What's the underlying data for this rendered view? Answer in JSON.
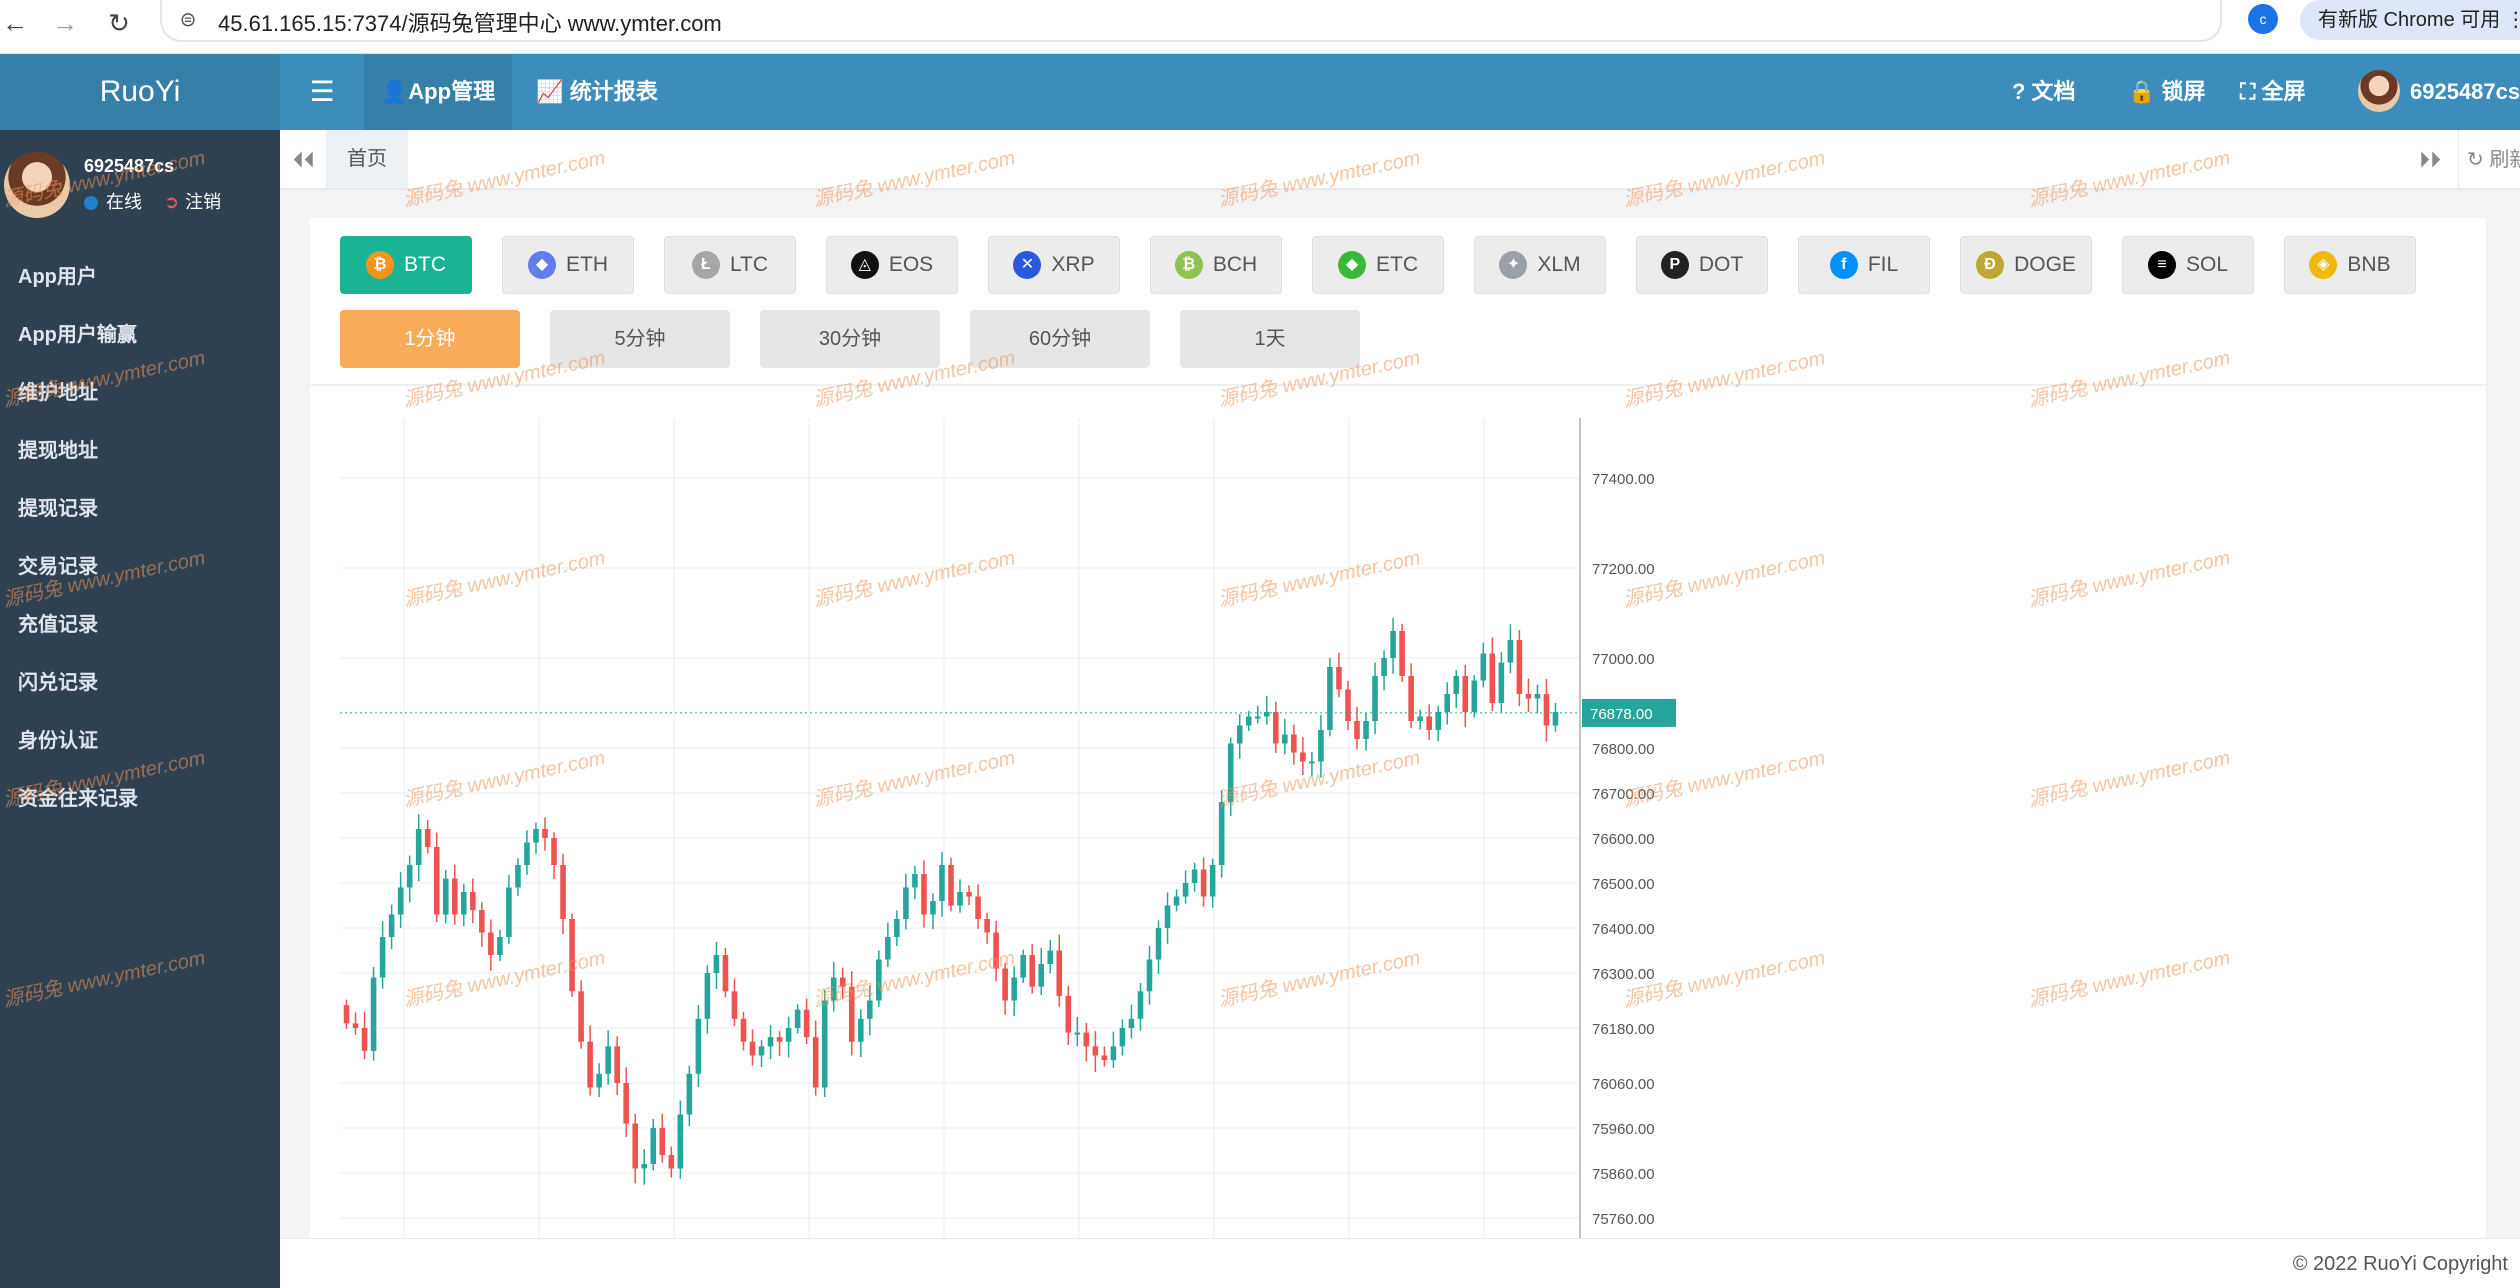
{
  "browser": {
    "back": "←",
    "forward": "→",
    "reload": "↻",
    "site_icon": "⊜",
    "url": "45.61.165.15:7374/源码兔管理中心  www.ymter.com",
    "profile_letter": "c",
    "update_label": "有新版 Chrome 可用  ⋮"
  },
  "header": {
    "brand": "RuoYi",
    "menu_icon": "☰",
    "nav": [
      {
        "label": "👤App管理"
      },
      {
        "label": "📈 统计报表"
      }
    ],
    "right": {
      "docs": "? 文档",
      "lock": "🔒 锁屏",
      "fullscreen": "⛶ 全屏",
      "username": "6925487cs"
    }
  },
  "sidebar": {
    "user": {
      "name": "6925487cs",
      "online": "在线",
      "logout": "注销"
    },
    "items": [
      {
        "label": "App用户"
      },
      {
        "label": "App用户输赢"
      },
      {
        "label": "维护地址"
      },
      {
        "label": "提现地址"
      },
      {
        "label": "提现记录"
      },
      {
        "label": "交易记录"
      },
      {
        "label": "充值记录"
      },
      {
        "label": "闪兑记录"
      },
      {
        "label": "身份认证"
      },
      {
        "label": "资金往来记录"
      }
    ]
  },
  "tabs": {
    "prev": "⏴⏴",
    "next": "⏵⏵",
    "home": "首页",
    "refresh": "↻ 刷新"
  },
  "coins": [
    {
      "label": "BTC",
      "icon": "bitcoin-icon",
      "symbol": "₿",
      "color": "#f7931a",
      "active": true
    },
    {
      "label": "ETH",
      "icon": "ethereum-icon",
      "symbol": "◆",
      "color": "#627eea",
      "active": false
    },
    {
      "label": "LTC",
      "icon": "litecoin-icon",
      "symbol": "Ł",
      "color": "#a6a6a6",
      "active": false
    },
    {
      "label": "EOS",
      "icon": "eos-icon",
      "symbol": "◬",
      "color": "#111111",
      "active": false
    },
    {
      "label": "XRP",
      "icon": "xrp-icon",
      "symbol": "✕",
      "color": "#2a5ada",
      "active": false
    },
    {
      "label": "BCH",
      "icon": "bitcoin-cash-icon",
      "symbol": "₿",
      "color": "#8dc351",
      "active": false
    },
    {
      "label": "ETC",
      "icon": "ethereum-classic-icon",
      "symbol": "◆",
      "color": "#3ab83a",
      "active": false
    },
    {
      "label": "XLM",
      "icon": "stellar-icon",
      "symbol": "✦",
      "color": "#9aa0a6",
      "active": false
    },
    {
      "label": "DOT",
      "icon": "polkadot-icon",
      "symbol": "P",
      "color": "#222222",
      "active": false
    },
    {
      "label": "FIL",
      "icon": "filecoin-icon",
      "symbol": "f",
      "color": "#0090ff",
      "active": false
    },
    {
      "label": "DOGE",
      "icon": "dogecoin-icon",
      "symbol": "Ð",
      "color": "#c2a633",
      "active": false
    },
    {
      "label": "SOL",
      "icon": "solana-icon",
      "symbol": "≡",
      "color": "#000000",
      "active": false
    },
    {
      "label": "BNB",
      "icon": "bnb-icon",
      "symbol": "◈",
      "color": "#f0b90b",
      "active": false
    }
  ],
  "timeframes": [
    {
      "label": "1分钟",
      "active": true
    },
    {
      "label": "5分钟",
      "active": false
    },
    {
      "label": "30分钟",
      "active": false
    },
    {
      "label": "60分钟",
      "active": false
    },
    {
      "label": "1天",
      "active": false
    }
  ],
  "chart_data": {
    "type": "candlestick",
    "symbol": "BTC",
    "interval": "1分钟",
    "y_ticks": [
      77400.0,
      77200.0,
      77000.0,
      76800.0,
      76700.0,
      76600.0,
      76500.0,
      76400.0,
      76300.0,
      76180.0,
      76060.0,
      75960.0,
      75860.0,
      75760.0
    ],
    "last_price": 76878.0,
    "last_price_label": "76878.00",
    "up_color": "#26a69a",
    "down_color": "#ef5350",
    "closes": [
      76190,
      76180,
      76130,
      76290,
      76380,
      76430,
      76490,
      76540,
      76620,
      76580,
      76430,
      76510,
      76430,
      76480,
      76440,
      76390,
      76340,
      76380,
      76490,
      76540,
      76590,
      76620,
      76600,
      76540,
      76420,
      76260,
      76150,
      76050,
      76080,
      76140,
      76060,
      75970,
      75870,
      75880,
      75960,
      75900,
      75870,
      75990,
      76080,
      76200,
      76300,
      76340,
      76260,
      76200,
      76150,
      76120,
      76140,
      76160,
      76150,
      76180,
      76220,
      76160,
      76050,
      76240,
      76290,
      76270,
      76150,
      76200,
      76240,
      76330,
      76380,
      76420,
      76490,
      76520,
      76430,
      76460,
      76540,
      76450,
      76480,
      76470,
      76420,
      76390,
      76310,
      76240,
      76290,
      76340,
      76270,
      76320,
      76350,
      76250,
      76170,
      76170,
      76140,
      76120,
      76110,
      76140,
      76180,
      76200,
      76260,
      76330,
      76400,
      76450,
      76470,
      76500,
      76530,
      76470,
      76540,
      76680,
      76810,
      76850,
      76870,
      76870,
      76880,
      76810,
      76830,
      76790,
      76770,
      76770,
      76840,
      76980,
      76930,
      76860,
      76820,
      76860,
      76960,
      77000,
      77060,
      76960,
      76860,
      76870,
      76840,
      76880,
      76920,
      76960,
      76880,
      76950,
      77010,
      76900,
      76990,
      77040,
      76920,
      76910,
      76920,
      76850,
      76880
    ]
  },
  "footer": {
    "copyright": "© 2022 RuoYi Copyright"
  },
  "watermark": "源码兔  www.ymter.com"
}
